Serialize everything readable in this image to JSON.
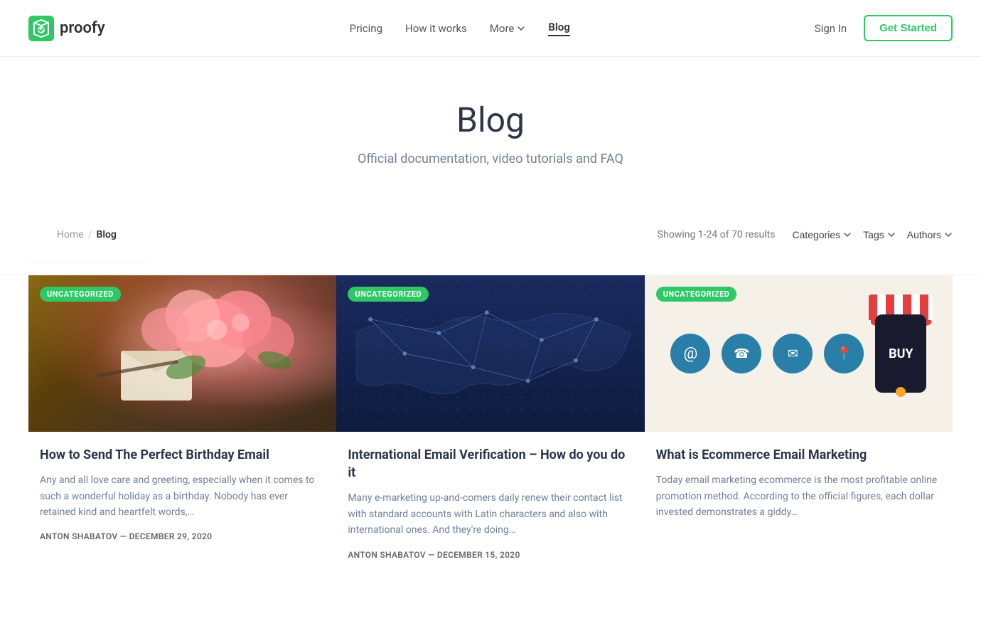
{
  "nav": {
    "logo_text": "proofy",
    "links": [
      {
        "id": "pricing",
        "label": "Pricing",
        "active": false
      },
      {
        "id": "how-it-works",
        "label": "How it works",
        "active": false
      },
      {
        "id": "more",
        "label": "More",
        "has_dropdown": true,
        "active": false
      },
      {
        "id": "blog",
        "label": "Blog",
        "active": true
      }
    ],
    "sign_in": "Sign In",
    "get_started": "Get Started"
  },
  "hero": {
    "title": "Blog",
    "subtitle": "Official documentation, video tutorials and FAQ"
  },
  "breadcrumb": {
    "home": "Home",
    "current": "Blog"
  },
  "filters": {
    "results_text": "Showing 1-24 of 70 results",
    "categories": "Categories",
    "tags": "Tags",
    "authors": "Authors"
  },
  "cards": [
    {
      "id": "birthday-email",
      "badge": "UNCATEGORIZED",
      "title": "How to Send The Perfect Birthday Email",
      "excerpt": "Any and all love care and greeting, especially when it comes to such a wonderful holiday as a birthday. Nobody has ever retained kind and heartfelt words,…",
      "author": "ANTON SHABATOV",
      "date": "DECEMBER 29, 2020",
      "type": "flowers"
    },
    {
      "id": "international-email",
      "badge": "UNCATEGORIZED",
      "title": "International Email Verification – How do you do it",
      "excerpt": "Many e-marketing up-and-comers daily renew their contact list with standard accounts with Latin characters and also with international ones. And they're doing…",
      "author": "ANTON SHABATOV",
      "date": "DECEMBER 15, 2020",
      "type": "worldmap"
    },
    {
      "id": "ecommerce-email",
      "badge": "UNCATEGORIZED",
      "title": "What is Ecommerce Email Marketing",
      "excerpt": "Today email marketing ecommerce is the most profitable online promotion method. According to the official figures, each dollar invested demonstrates a giddy…",
      "author": "",
      "date": "",
      "type": "ecommerce"
    }
  ]
}
